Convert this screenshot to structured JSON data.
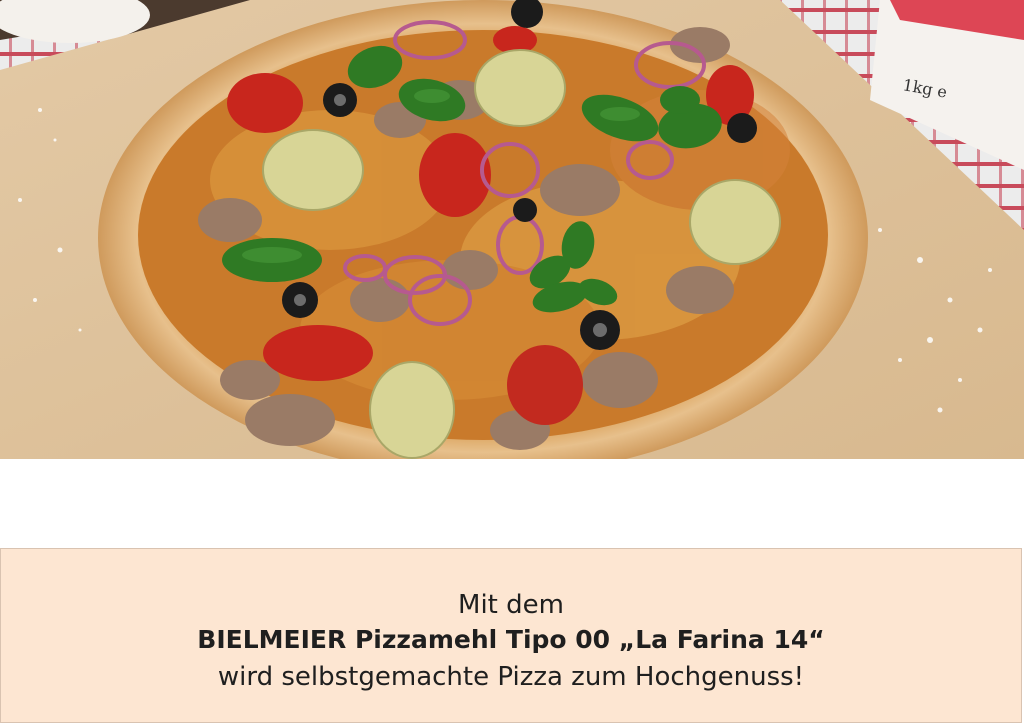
{
  "hero": {
    "image_subject": "pizza-on-wooden-board"
  },
  "bag_label": {
    "weight": "1kg e"
  },
  "caption": {
    "line1": "Mit dem",
    "line2": "BIELMEIER Pizzamehl Tipo 00 „La Farina 14“",
    "line3": "wird selbstgemachte Pizza zum Hochgenuss!"
  },
  "colors": {
    "caption_background": "#fde6d2",
    "caption_border": "#d9c3b1",
    "text": "#1f1f1f"
  }
}
